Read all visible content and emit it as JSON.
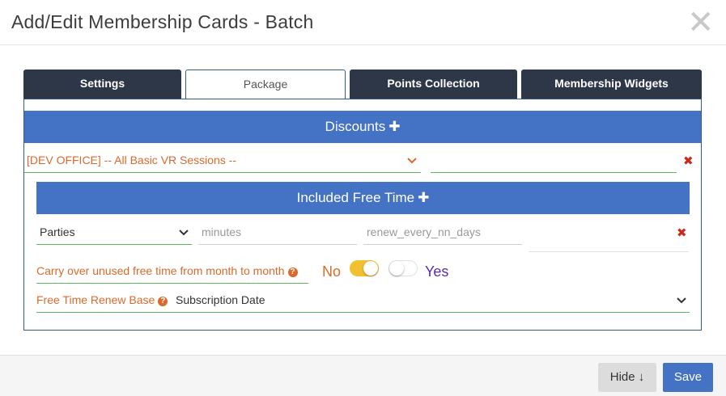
{
  "header": {
    "title": "Add/Edit Membership Cards - Batch",
    "close_symbol": "✕"
  },
  "tabs": [
    {
      "label": "Settings",
      "active": false
    },
    {
      "label": "Package",
      "active": true
    },
    {
      "label": "Points Collection",
      "active": false
    },
    {
      "label": "Membership Widgets",
      "active": false
    }
  ],
  "discounts": {
    "title": "Discounts",
    "plus": "✚",
    "selected": "[DEV OFFICE] -- All Basic VR Sessions --",
    "value": "",
    "remove_symbol": "✖"
  },
  "free_time": {
    "title": "Included Free Time",
    "plus": "✚",
    "type_selected": "Parties",
    "minutes_placeholder": "minutes",
    "renew_placeholder": "renew_every_nn_days",
    "remove_symbol": "✖"
  },
  "carry_over": {
    "label": "Carry over unused free time from month to month",
    "help": "?",
    "no_label": "No",
    "yes_label": "Yes",
    "no_on": true,
    "yes_on": false
  },
  "renew_base": {
    "label": "Free Time Renew Base",
    "help": "?",
    "selected": "Subscription Date"
  },
  "footer": {
    "hide_label": "Hide ↓",
    "save_label": "Save"
  },
  "colors": {
    "accent_blue": "#4472c4",
    "tab_dark": "#2d3748",
    "orange_label": "#d96a2b",
    "green_underline": "#5cb85c",
    "toggle_yellow": "#f0c030",
    "remove_red": "#d0261b",
    "yes_purple": "#5a2ea6"
  }
}
